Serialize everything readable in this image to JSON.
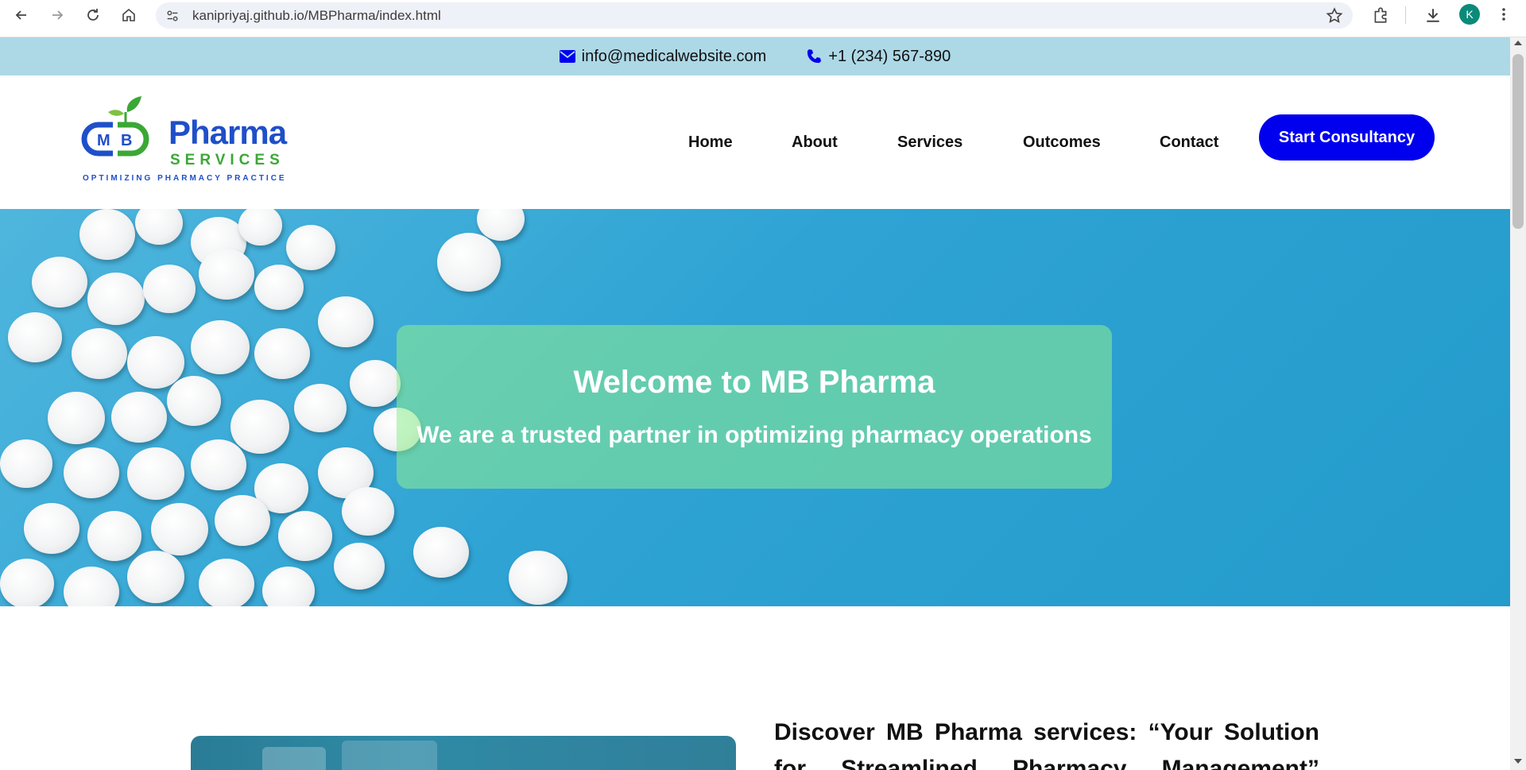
{
  "browser": {
    "url": "kanipriyaj.github.io/MBPharma/index.html",
    "profile_initial": "K"
  },
  "topbar": {
    "email": "info@medicalwebsite.com",
    "phone": "+1 (234) 567-890"
  },
  "logo": {
    "brand_initials": "MB",
    "name": "Pharma",
    "services": "SERVICES",
    "tagline": "OPTIMIZING PHARMACY PRACTICE"
  },
  "nav": {
    "items": [
      "Home",
      "About",
      "Services",
      "Outcomes",
      "Contact"
    ],
    "cta": "Start Consultancy"
  },
  "hero": {
    "title": "Welcome to MB Pharma",
    "subtitle": "We are a trusted partner in optimizing pharmacy operations"
  },
  "discover": {
    "heading": "Discover MB Pharma services: “Your Solution for Streamlined Pharmacy Management”"
  },
  "colors": {
    "topbar": "#add8e6",
    "cta": "#0000ee",
    "hero_box": "rgba(144,238,144,0.55)",
    "brand_blue": "#1f4fc9",
    "brand_green": "#3aa835"
  }
}
